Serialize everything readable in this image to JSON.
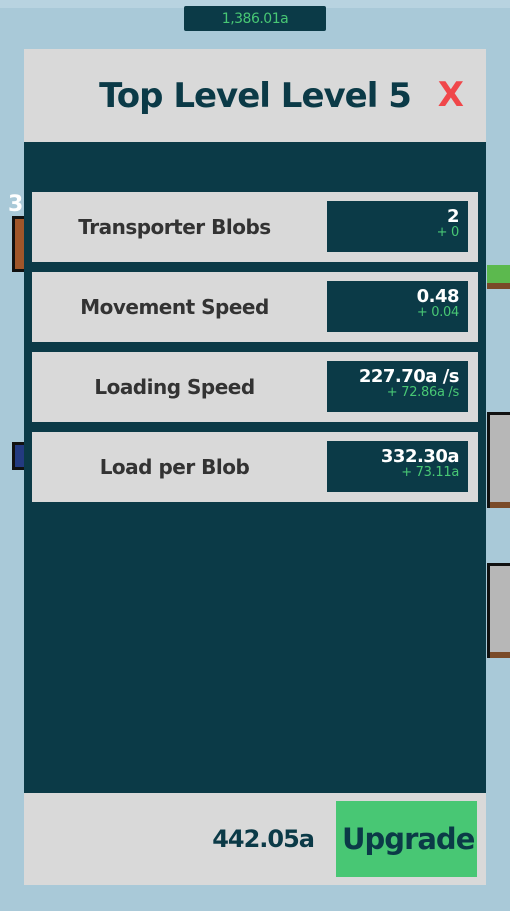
{
  "currency": {
    "amount": "1,386.01a"
  },
  "background": {
    "left_label": "3"
  },
  "dialog": {
    "title": "Top Level Level 5",
    "close_label": "X",
    "stats": [
      {
        "label": "Transporter Blobs",
        "value": "2",
        "increment": "+ 0"
      },
      {
        "label": "Movement Speed",
        "value": "0.48",
        "increment": "+ 0.04"
      },
      {
        "label": "Loading Speed",
        "value": "227.70a /s",
        "increment": "+ 72.86a /s"
      },
      {
        "label": "Load per Blob",
        "value": "332.30a",
        "increment": "+ 73.11a"
      }
    ],
    "upgrade_cost": "442.05a",
    "upgrade_label": "Upgrade"
  },
  "colors": {
    "panel": "#0b3a47",
    "header": "#d9d9d9",
    "accent_green": "#48c774",
    "close_red": "#f0474a",
    "background": "#a9c9d8"
  }
}
